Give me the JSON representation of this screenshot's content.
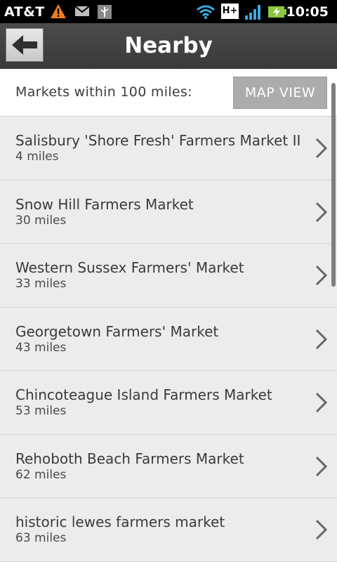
{
  "status_bar": {
    "carrier": "AT&T",
    "network_label": "H+",
    "time": "10:05",
    "icons": [
      "warning-icon",
      "mail-icon",
      "usb-icon",
      "wifi-icon",
      "network-type-icon",
      "signal-icon",
      "battery-charging-icon"
    ]
  },
  "header": {
    "title": "Nearby",
    "back_icon": "back-arrow-icon"
  },
  "filter": {
    "label": "Markets within 100 miles:",
    "map_button": "MAP VIEW"
  },
  "markets": [
    {
      "name": "Salisbury 'Shore Fresh' Farmers Market II",
      "distance": "4 miles"
    },
    {
      "name": "Snow Hill Farmers Market",
      "distance": "30 miles"
    },
    {
      "name": "Western Sussex Farmers' Market",
      "distance": "33 miles"
    },
    {
      "name": "Georgetown Farmers' Market",
      "distance": "43 miles"
    },
    {
      "name": "Chincoteague Island Farmers Market",
      "distance": "53 miles"
    },
    {
      "name": "Rehoboth Beach Farmers Market",
      "distance": "62 miles"
    },
    {
      "name": "historic lewes farmers market",
      "distance": "63 miles"
    }
  ],
  "colors": {
    "warning": "#f07d1a",
    "wifi": "#3aa9e0",
    "signal": "#3aa9e0",
    "battery": "#8cc63f"
  }
}
